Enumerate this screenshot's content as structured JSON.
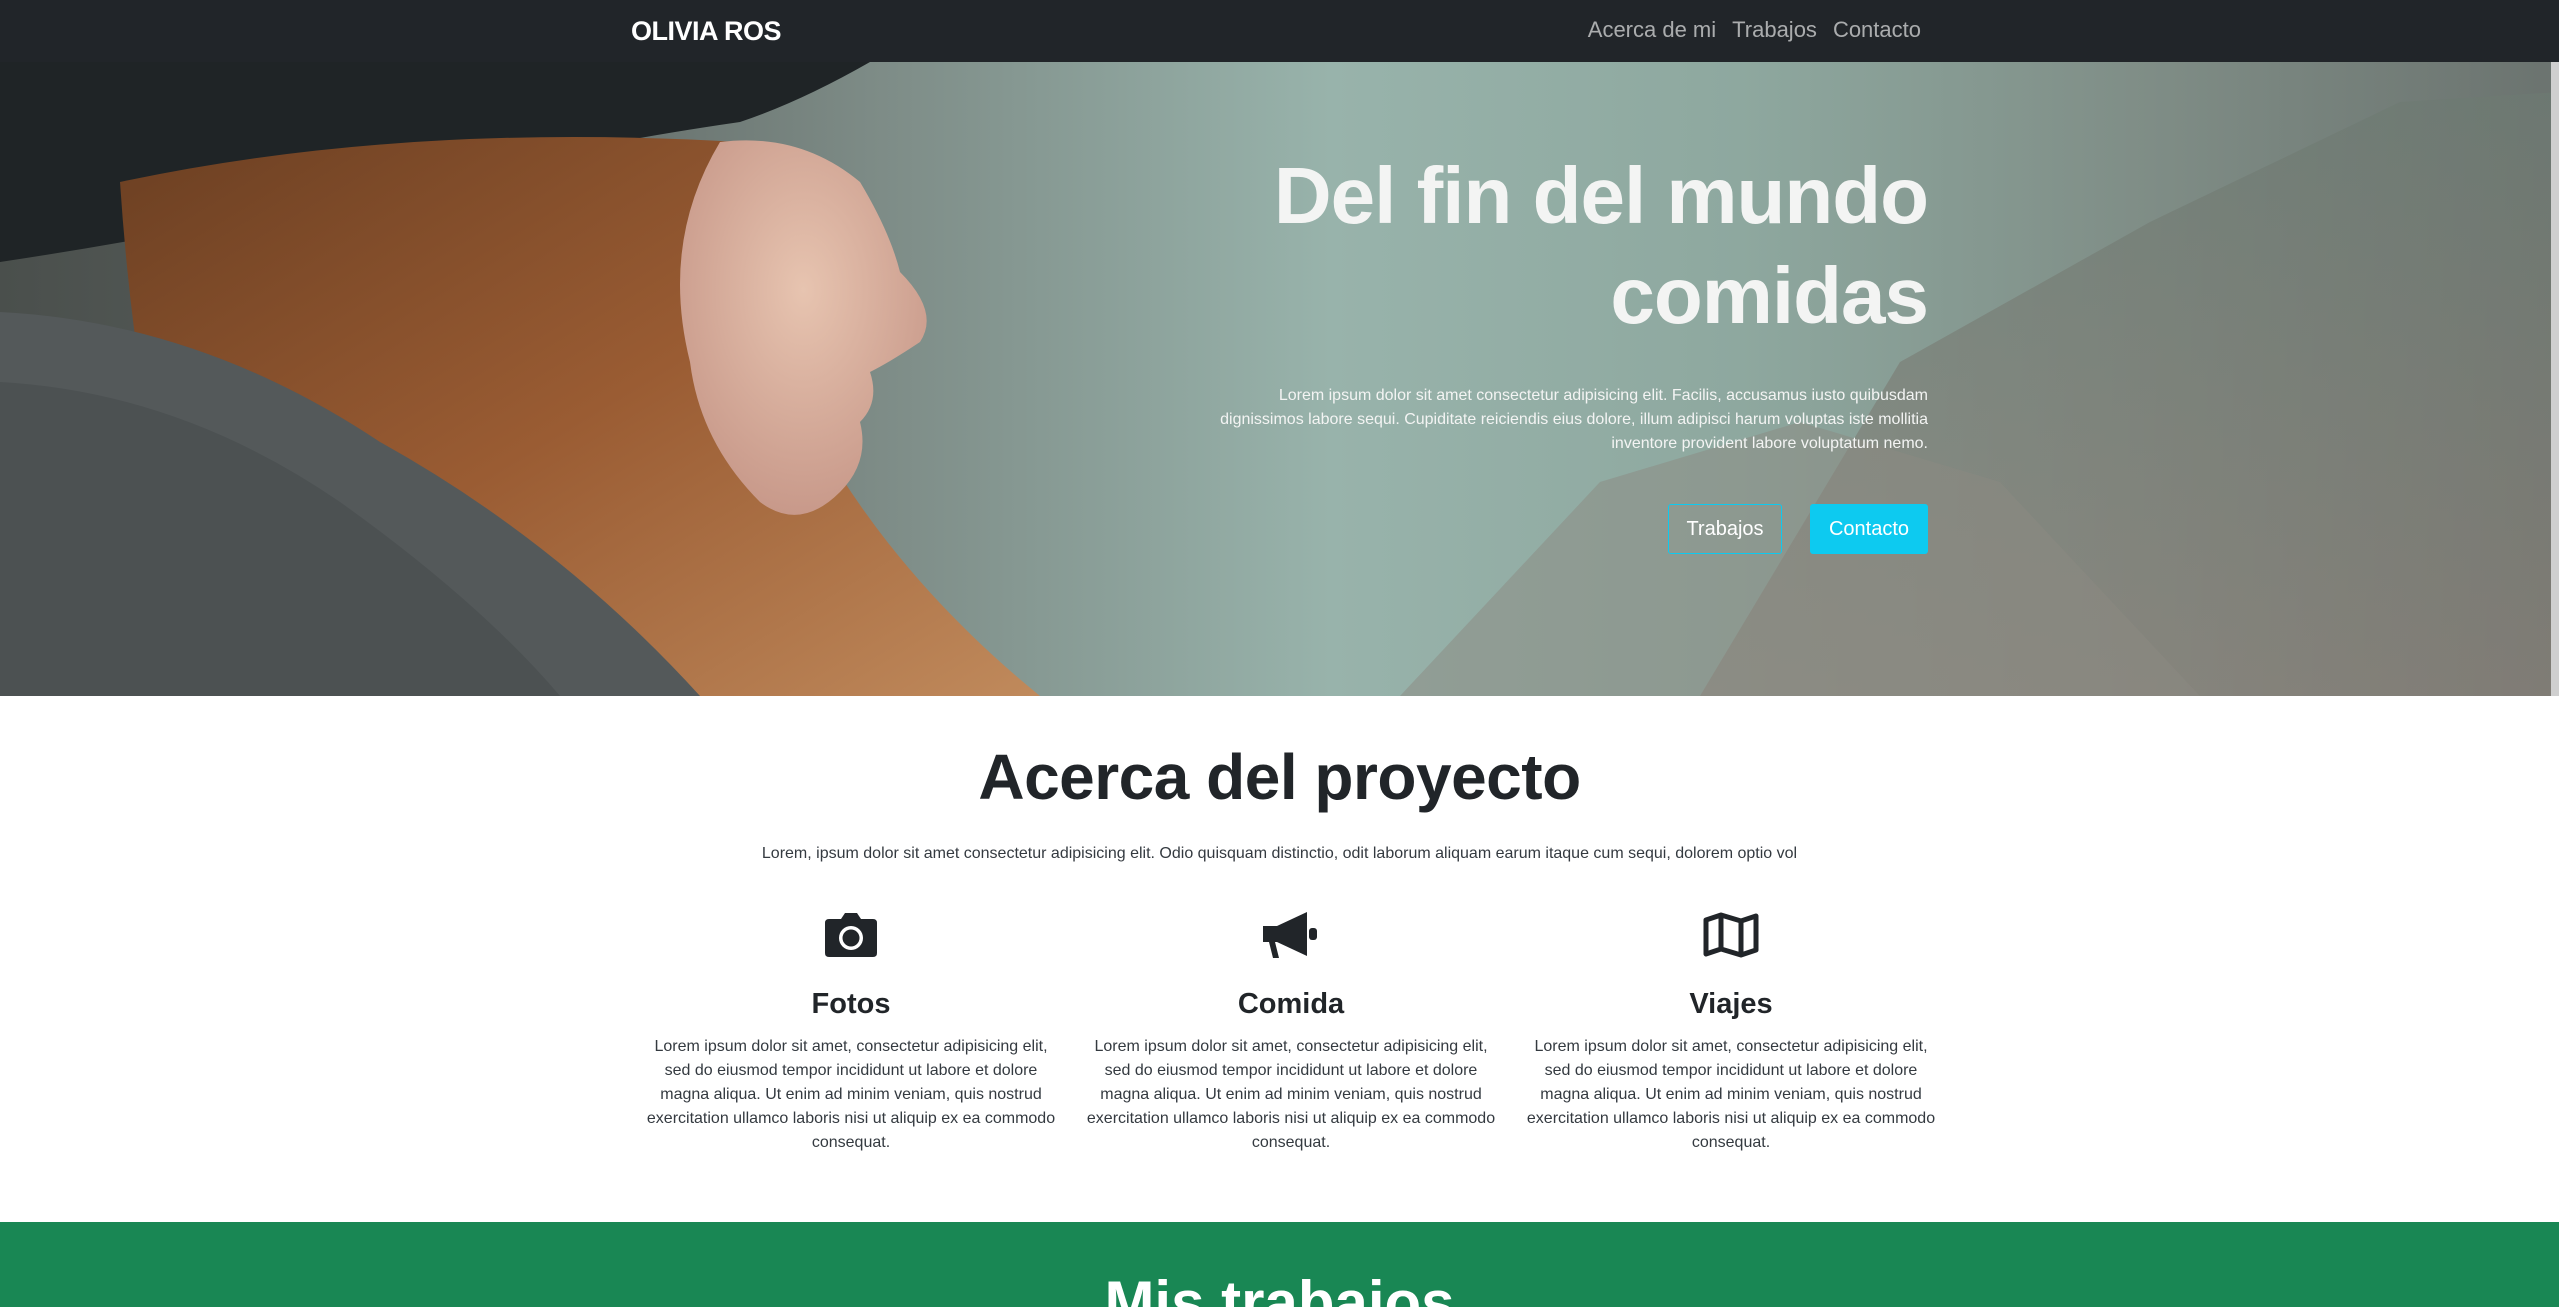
{
  "navbar": {
    "brand": "OLIVIA ROS",
    "links": [
      "Acerca de mi",
      "Trabajos",
      "Contacto"
    ]
  },
  "hero": {
    "title_line1": "Del fin del mundo",
    "title_line2": "comidas",
    "text_line1": "Lorem ipsum dolor sit amet consectetur adipisicing elit. Facilis, accusamus iusto quibusdam",
    "text_line2": "dignissimos labore sequi. Cupiditate reiciendis eius dolore, illum adipisci harum voluptas iste mollitia",
    "text_line3": "inventore provident labore voluptatum nemo.",
    "btn_outline": "Trabajos",
    "btn_primary": "Contacto"
  },
  "about": {
    "title": "Acerca del proyecto",
    "lead": "Lorem, ipsum dolor sit amet consectetur adipisicing elit. Odio quisquam distinctio, odit laborum aliquam earum itaque cum sequi, dolorem optio vol",
    "features": [
      {
        "icon": "camera-icon",
        "title": "Fotos",
        "text": "Lorem ipsum dolor sit amet, consectetur adipisicing elit, sed do eiusmod tempor incididunt ut labore et dolore magna aliqua. Ut enim ad minim veniam, quis nostrud exercitation ullamco laboris nisi ut aliquip ex ea commodo consequat."
      },
      {
        "icon": "megaphone-icon",
        "title": "Comida",
        "text": "Lorem ipsum dolor sit amet, consectetur adipisicing elit, sed do eiusmod tempor incididunt ut labore et dolore magna aliqua. Ut enim ad minim veniam, quis nostrud exercitation ullamco laboris nisi ut aliquip ex ea commodo consequat."
      },
      {
        "icon": "map-icon",
        "title": "Viajes",
        "text": "Lorem ipsum dolor sit amet, consectetur adipisicing elit, sed do eiusmod tempor incididunt ut labore et dolore magna aliqua. Ut enim ad minim veniam, quis nostrud exercitation ullamco laboris nisi ut aliquip ex ea commodo consequat."
      }
    ]
  },
  "works": {
    "title": "Mis trabajos"
  },
  "colors": {
    "navbar_bg": "#212529",
    "accent_info": "#0dcaf0",
    "works_bg": "#198754"
  }
}
